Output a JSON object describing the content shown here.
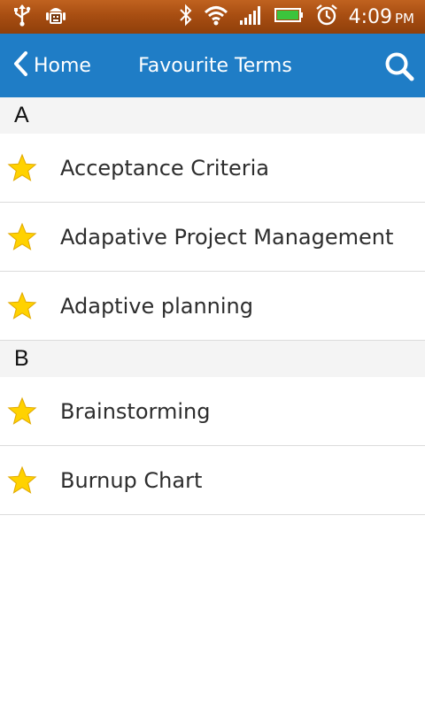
{
  "status_bar": {
    "time": "4:09",
    "ampm": "PM",
    "icons": [
      "usb-icon",
      "android-debug-icon",
      "bluetooth-icon",
      "wifi-icon",
      "signal-icon",
      "battery-icon",
      "alarm-icon"
    ],
    "colors": {
      "background": "#a84e12",
      "battery": "#3cc43c"
    }
  },
  "app_bar": {
    "back_label": "Home",
    "title": "Favourite Terms",
    "search_icon": "search-icon",
    "color": "#1f7dc6"
  },
  "sections": [
    {
      "letter": "A",
      "items": [
        "Acceptance Criteria",
        "Adapative Project Management",
        "Adaptive planning"
      ]
    },
    {
      "letter": "B",
      "items": [
        "Brainstorming",
        "Burnup Chart"
      ]
    }
  ],
  "item_icon": "star-icon",
  "star_color": "#ffd200"
}
